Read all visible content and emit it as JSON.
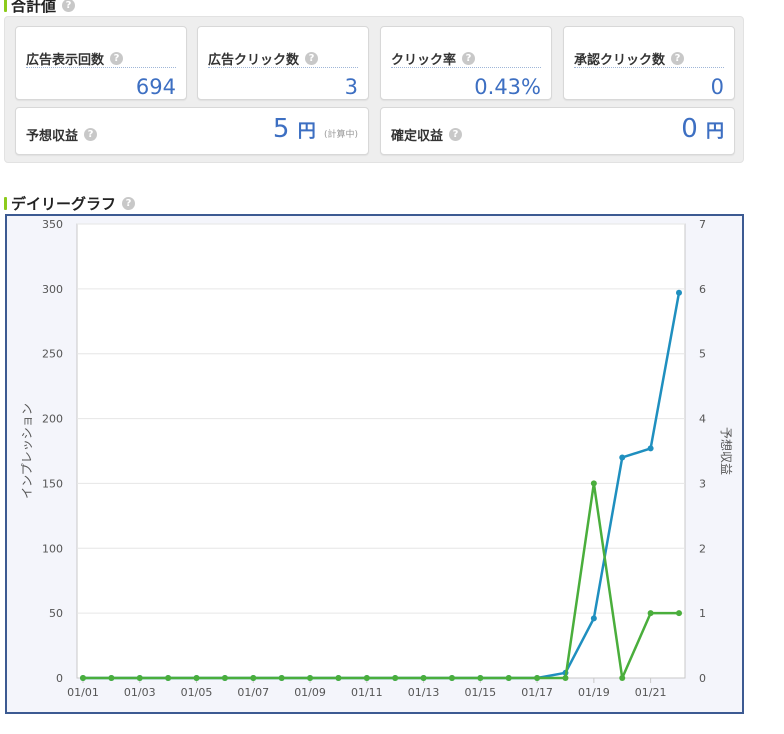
{
  "summary": {
    "title": "合計値",
    "cards": [
      {
        "label": "広告表示回数",
        "value": "694"
      },
      {
        "label": "広告クリック数",
        "value": "3"
      },
      {
        "label": "クリック率",
        "value": "0.43%"
      },
      {
        "label": "承認クリック数",
        "value": "0"
      }
    ],
    "expected": {
      "label": "予想収益",
      "value": "5",
      "unit": "円",
      "note": "(計算中)"
    },
    "confirmed": {
      "label": "確定収益",
      "value": "0",
      "unit": "円"
    }
  },
  "graph": {
    "title": "デイリーグラフ"
  },
  "help_glyph": "?",
  "chart_data": {
    "type": "line",
    "x": [
      "01/01",
      "01/02",
      "01/03",
      "01/04",
      "01/05",
      "01/06",
      "01/07",
      "01/08",
      "01/09",
      "01/10",
      "01/11",
      "01/12",
      "01/13",
      "01/14",
      "01/15",
      "01/16",
      "01/17",
      "01/18",
      "01/19",
      "01/20",
      "01/21",
      "01/22"
    ],
    "xticks": [
      "01/01",
      "01/03",
      "01/05",
      "01/07",
      "01/09",
      "01/11",
      "01/13",
      "01/15",
      "01/17",
      "01/19",
      "01/21"
    ],
    "ylabel": "インプレッション",
    "y2label": "予想収益",
    "ylim": [
      0,
      350
    ],
    "y2lim": [
      0,
      7
    ],
    "yticks": [
      0,
      50,
      100,
      150,
      200,
      250,
      300,
      350
    ],
    "y2ticks": [
      0,
      1,
      2,
      3,
      4,
      5,
      6,
      7
    ],
    "grid": true,
    "series": [
      {
        "axis": "left",
        "color": "#1f8fbf",
        "values": [
          0,
          0,
          0,
          0,
          0,
          0,
          0,
          0,
          0,
          0,
          0,
          0,
          0,
          0,
          0,
          0,
          0,
          4,
          46,
          170,
          177,
          297
        ]
      },
      {
        "axis": "right",
        "color": "#4aae3c",
        "values": [
          0,
          0,
          0,
          0,
          0,
          0,
          0,
          0,
          0,
          0,
          0,
          0,
          0,
          0,
          0,
          0,
          0,
          0,
          3,
          0,
          1,
          1
        ]
      }
    ]
  }
}
